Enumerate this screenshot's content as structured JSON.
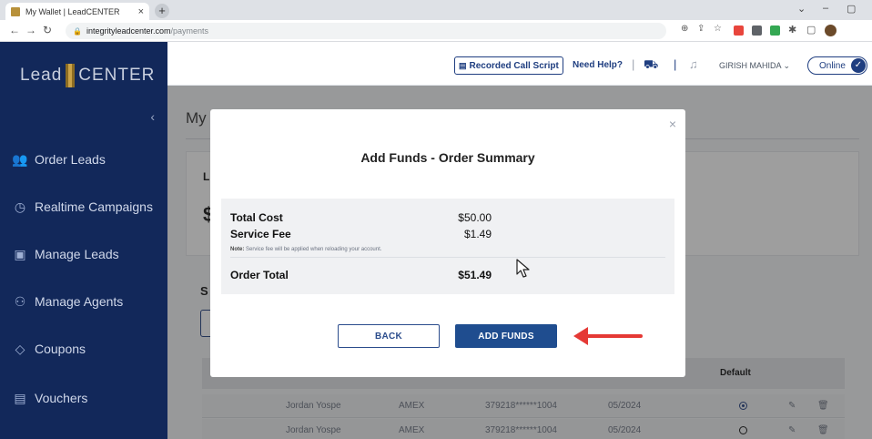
{
  "browser": {
    "tab_title": "My Wallet | LeadCENTER",
    "tab_close": "×",
    "new_tab": "+",
    "url_host": "integrityleadcenter.com",
    "url_path": "/payments"
  },
  "sidebar": {
    "logo_left": "Lead",
    "logo_right": "CENTER",
    "collapse": "‹",
    "items": [
      {
        "label": "Order Leads",
        "icon": "👥"
      },
      {
        "label": "Realtime Campaigns",
        "icon": "◷"
      },
      {
        "label": "Manage Leads",
        "icon": "▣"
      },
      {
        "label": "Manage Agents",
        "icon": "⚇"
      },
      {
        "label": "Coupons",
        "icon": "◇"
      },
      {
        "label": "Vouchers",
        "icon": "▤"
      }
    ]
  },
  "header": {
    "recorded_call_script": "Recorded Call Script",
    "need_help": "Need Help?",
    "user_name": "GIRISH MAHIDA",
    "status": "Online"
  },
  "page": {
    "title": "My",
    "card_label": "L",
    "card_amount": "$",
    "section_label": "S",
    "table_header_default": "Default",
    "rows": [
      {
        "name": "Jordan Yospe",
        "type": "AMEX",
        "number": "379218******1004",
        "expiry": "05/2024",
        "default": true
      },
      {
        "name": "Jordan Yospe",
        "type": "AMEX",
        "number": "379218******1004",
        "expiry": "05/2024",
        "default": false
      }
    ]
  },
  "modal": {
    "close": "×",
    "title": "Add Funds - Order Summary",
    "total_cost_label": "Total Cost",
    "total_cost_value": "$50.00",
    "service_fee_label": "Service Fee",
    "service_fee_value": "$1.49",
    "note_prefix": "Note:",
    "note_text": "Service fee will be applied when reloading your account.",
    "order_total_label": "Order Total",
    "order_total_value": "$51.49",
    "back_label": "BACK",
    "add_funds_label": "ADD FUNDS"
  },
  "colors": {
    "sidebar_bg": "#12285a",
    "primary": "#1f4d8f",
    "annotation_arrow": "#e53935"
  }
}
